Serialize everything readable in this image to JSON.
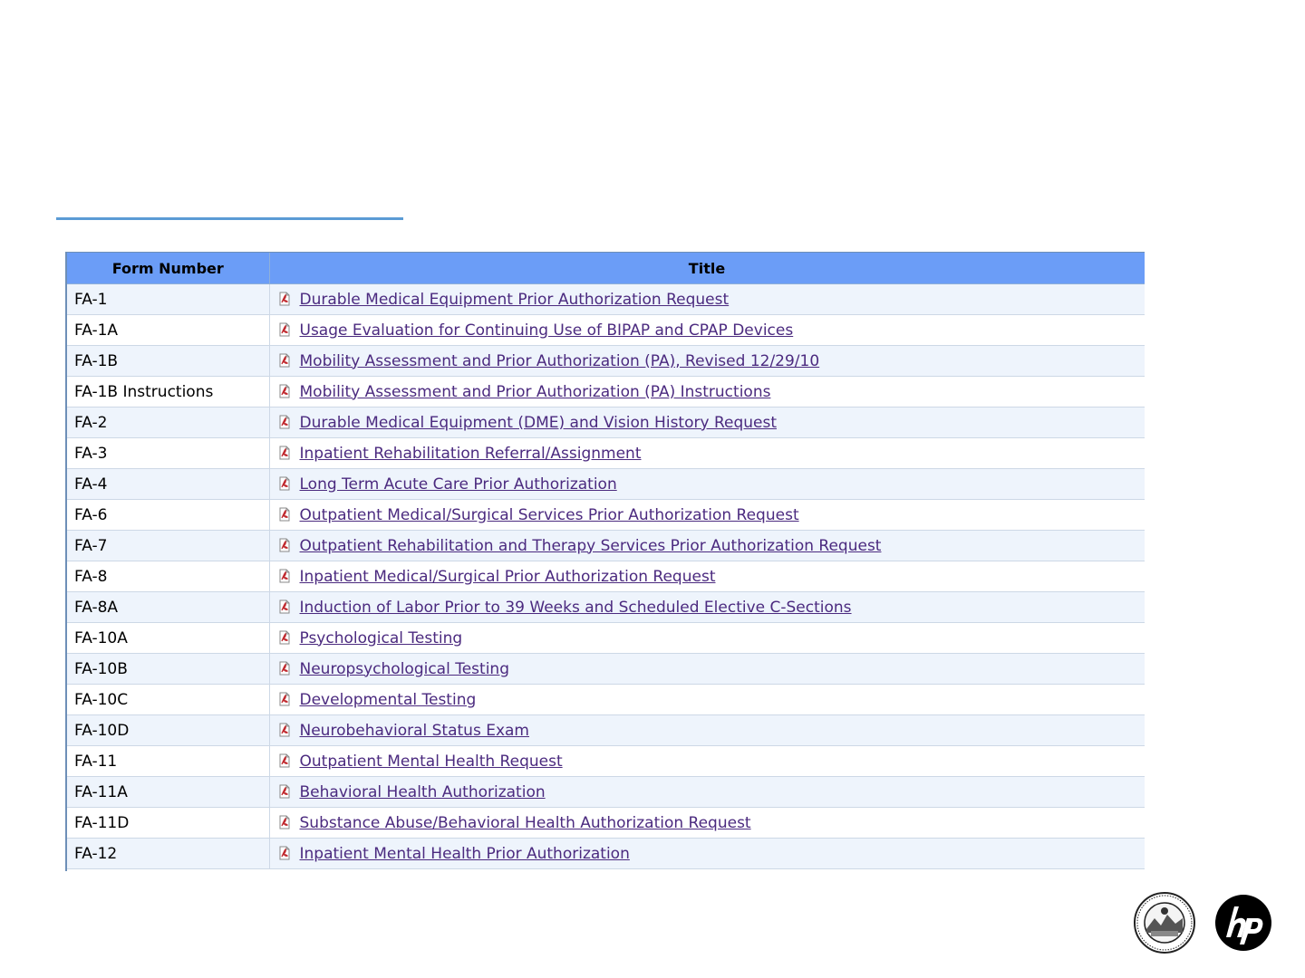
{
  "table": {
    "headers": [
      "Form Number",
      "Title"
    ],
    "rows": [
      {
        "form": "FA-1",
        "title": "Durable Medical Equipment Prior Authorization Request"
      },
      {
        "form": "FA-1A",
        "title": "Usage Evaluation for Continuing Use of BIPAP and CPAP Devices"
      },
      {
        "form": "FA-1B",
        "title": "Mobility Assessment and Prior Authorization (PA), Revised 12/29/10"
      },
      {
        "form": "FA-1B Instructions",
        "title": "Mobility Assessment and Prior Authorization (PA) Instructions"
      },
      {
        "form": "FA-2",
        "title": "Durable Medical Equipment (DME) and Vision History Request"
      },
      {
        "form": "FA-3",
        "title": "Inpatient Rehabilitation Referral/Assignment"
      },
      {
        "form": "FA-4",
        "title": "Long Term Acute Care Prior Authorization"
      },
      {
        "form": "FA-6",
        "title": "Outpatient Medical/Surgical Services Prior Authorization Request"
      },
      {
        "form": "FA-7",
        "title": "Outpatient Rehabilitation and Therapy Services Prior Authorization Request"
      },
      {
        "form": "FA-8",
        "title": "Inpatient Medical/Surgical Prior Authorization Request"
      },
      {
        "form": "FA-8A",
        "title": "Induction of Labor Prior to 39 Weeks and Scheduled Elective C-Sections"
      },
      {
        "form": "FA-10A",
        "title": "Psychological Testing"
      },
      {
        "form": "FA-10B",
        "title": "Neuropsychological Testing"
      },
      {
        "form": "FA-10C",
        "title": "Developmental Testing"
      },
      {
        "form": "FA-10D",
        "title": "Neurobehavioral Status Exam"
      },
      {
        "form": "FA-11",
        "title": "Outpatient Mental Health Request"
      },
      {
        "form": "FA-11A",
        "title": "Behavioral Health Authorization"
      },
      {
        "form": "FA-11D",
        "title": "Substance Abuse/Behavioral Health Authorization Request"
      },
      {
        "form": "FA-12",
        "title": "Inpatient Mental Health Prior Authorization"
      }
    ]
  },
  "icons": {
    "row_icon": "pdf-icon",
    "logos": [
      "state-seal-icon",
      "hp-logo-icon"
    ]
  },
  "colors": {
    "header_bg": "#6b9df7",
    "row_alt_bg": "#eef4fc",
    "link": "#4b2a7f",
    "title_rule": "#5b9bd5"
  }
}
